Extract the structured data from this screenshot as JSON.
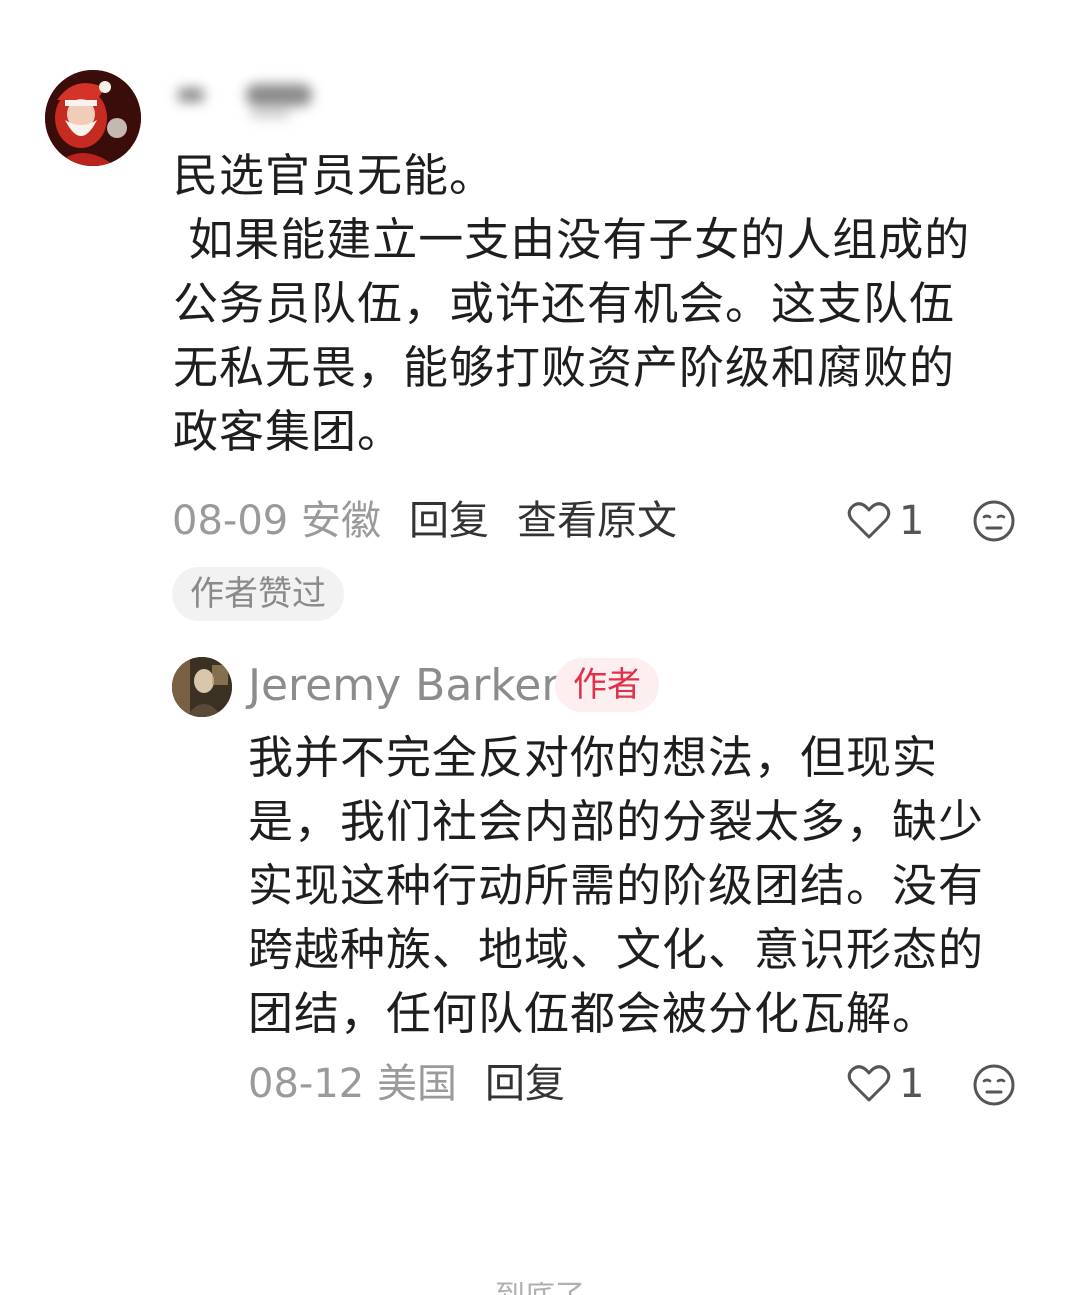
{
  "comment": {
    "avatar": "santa-avatar",
    "lines": [
      "民选官员无能。",
      " 如果能建立一支由没有子女的人组成的",
      "公务员队伍，或许还有机会。这支队伍",
      "无私无畏，能够打败资产阶级和腐败的",
      "政客集团。"
    ],
    "date_location": "08-09 安徽",
    "reply_label": "回复",
    "view_original_label": "查看原文",
    "like_count": "1",
    "author_liked_badge": "作者赞过"
  },
  "reply": {
    "avatar": "user-photo-avatar",
    "username": "Jeremy Barker",
    "author_badge": "作者",
    "lines": [
      "我并不完全反对你的想法，但现实",
      "是，我们社会内部的分裂太多，缺少",
      "实现这种行动所需的阶级团结。没有",
      "跨越种族、地域、文化、意识形态的",
      "团结，任何队伍都会被分化瓦解。"
    ],
    "date_location": "08-12 美国",
    "reply_label": "回复",
    "like_count": "1"
  },
  "footer": {
    "hint": "到底了"
  },
  "colors": {
    "author_badge_text": "#e0324a",
    "author_badge_bg": "#fdeef0",
    "muted": "#9a9a9a"
  }
}
